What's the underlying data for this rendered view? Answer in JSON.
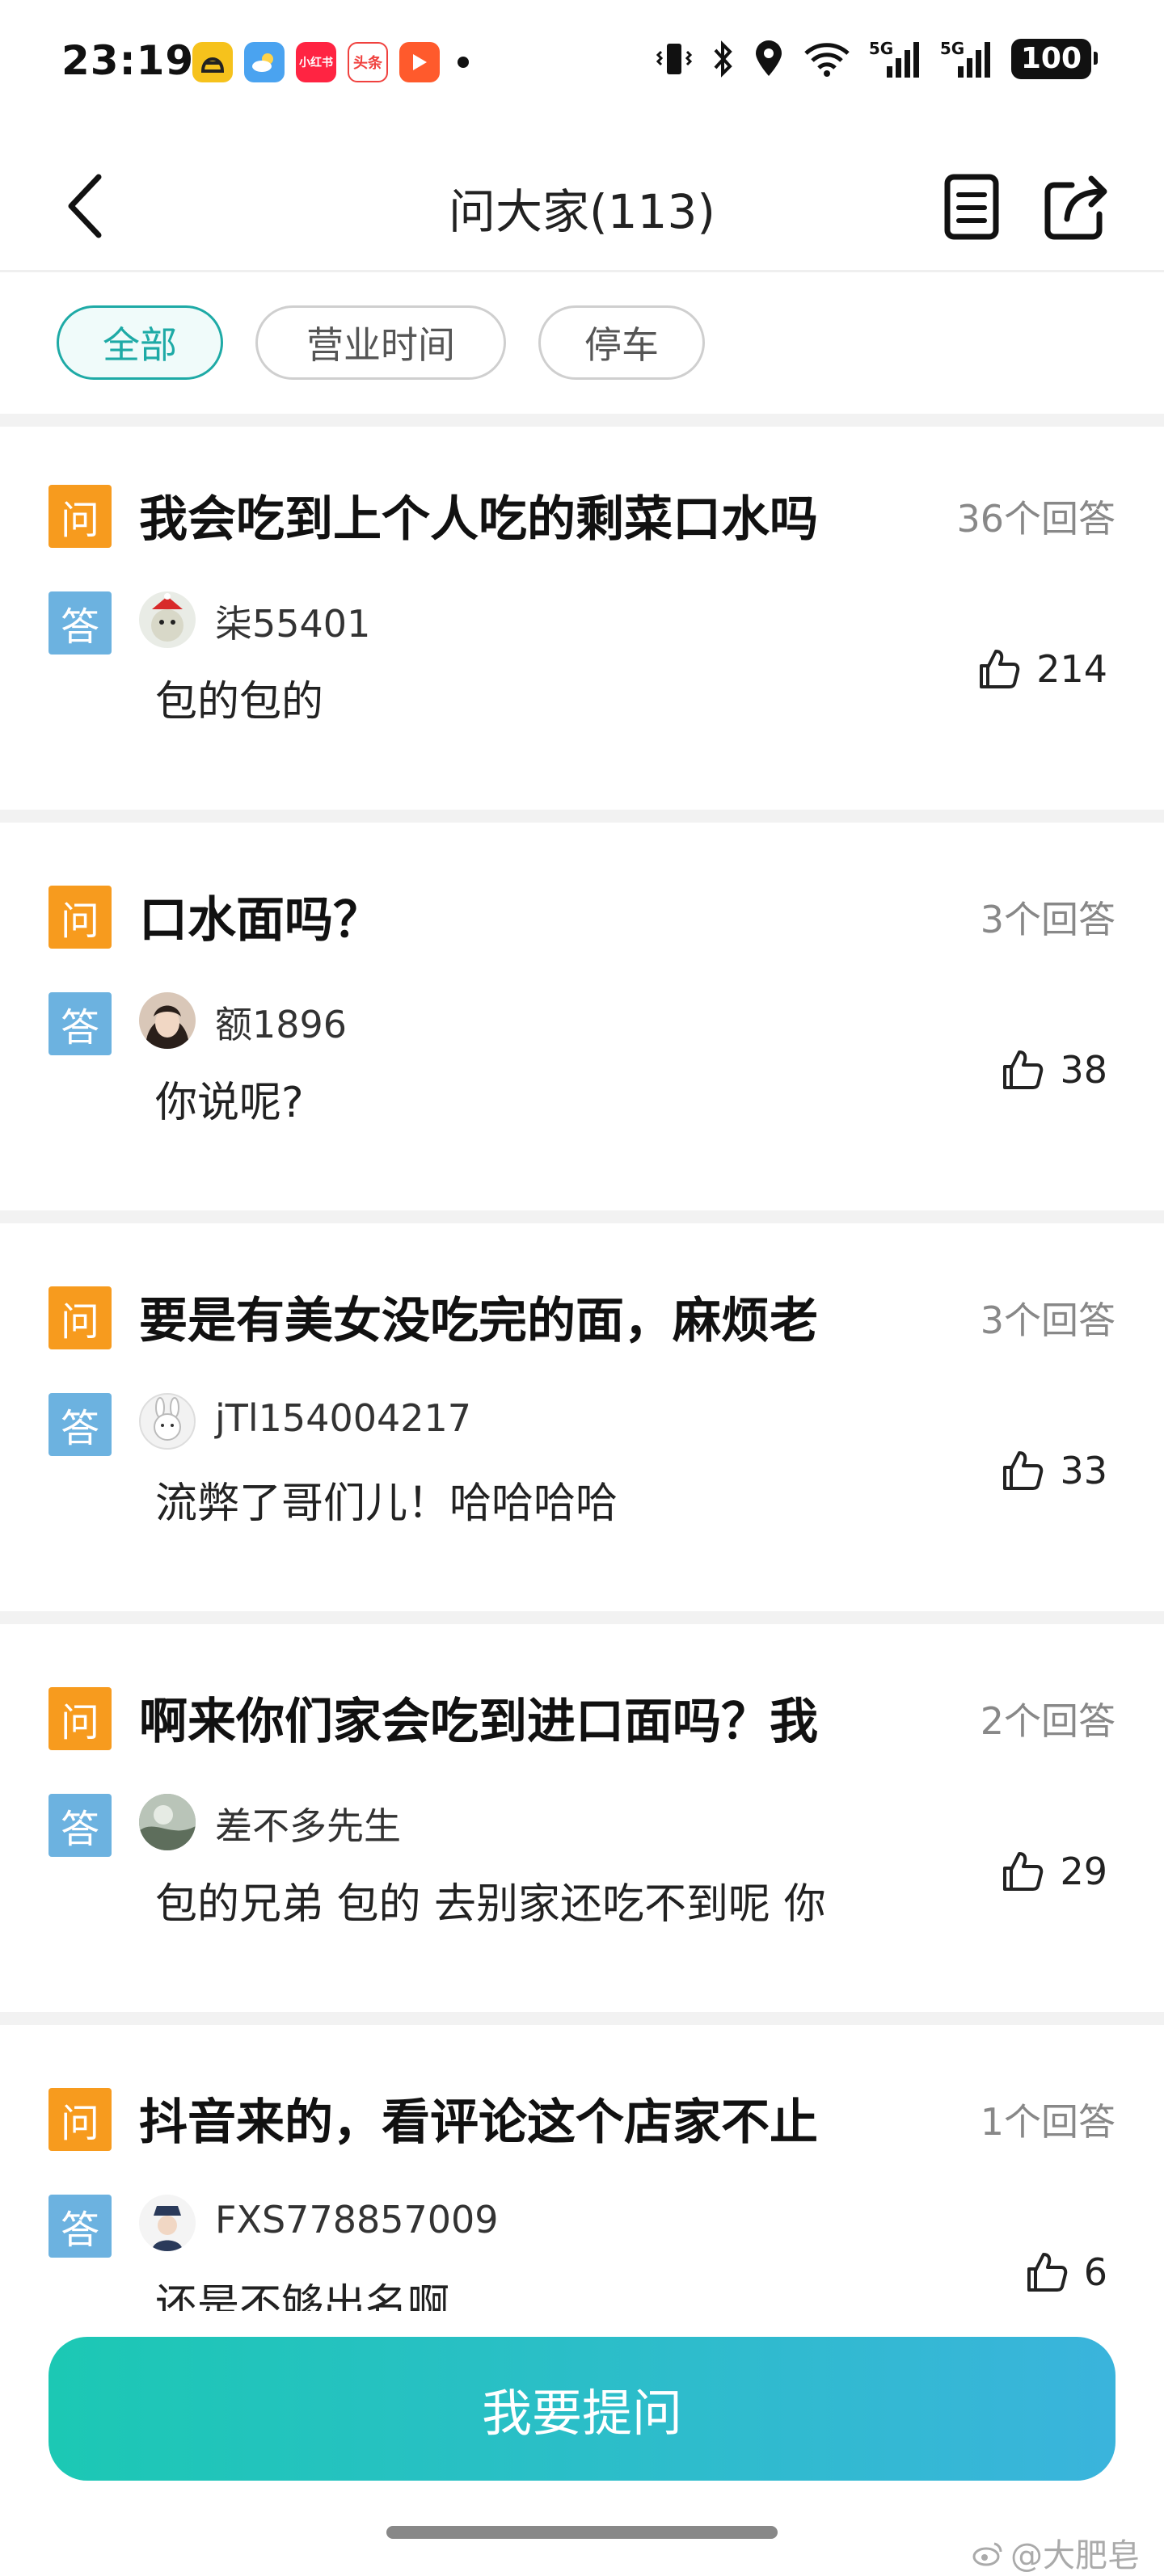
{
  "status_bar": {
    "time": "23:19",
    "apps": [
      {
        "icon": "gaode-app-icon",
        "color": "#f6c21c",
        "label": ""
      },
      {
        "icon": "weather-app-icon",
        "color": "#4aa3f0",
        "label": ""
      },
      {
        "icon": "xiaohongshu-app-icon",
        "color": "#ff2442",
        "label": "小红书"
      },
      {
        "icon": "toutiao-app-icon",
        "color": "#f0413e",
        "label": "头条"
      },
      {
        "icon": "video-app-icon",
        "color": "#ff5a2c",
        "label": ""
      }
    ],
    "battery": "100",
    "signal_1": "5G",
    "signal_2": "5G"
  },
  "navbar": {
    "title": "问大家(113)"
  },
  "filters": [
    {
      "label": "全部",
      "active": true
    },
    {
      "label": "营业时间",
      "active": false
    },
    {
      "label": "停车",
      "active": false
    }
  ],
  "items": [
    {
      "q_badge": "问",
      "question": "我会吃到上个人吃的剩菜口水吗",
      "count": "36个回答",
      "a_badge": "答",
      "user": "柒55401",
      "answer": "包的包的",
      "likes": "214",
      "avatar_color": "#3a5a3a"
    },
    {
      "q_badge": "问",
      "question": "口水面吗？",
      "count": "3个回答",
      "a_badge": "答",
      "user": "额1896",
      "answer": "你说呢?",
      "likes": "38",
      "avatar_color": "#6b4b3e"
    },
    {
      "q_badge": "问",
      "question": "要是有美女没吃完的面，麻烦老",
      "count": "3个回答",
      "a_badge": "答",
      "user": "jTl154004217",
      "answer": "流弊了哥们儿！哈哈哈哈",
      "likes": "33",
      "avatar_color": "#e8e8e8"
    },
    {
      "q_badge": "问",
      "question": "啊来你们家会吃到进口面吗？我",
      "count": "2个回答",
      "a_badge": "答",
      "user": "差不多先生",
      "answer": "包的兄弟 包的 去别家还吃不到呢 你",
      "likes": "29",
      "avatar_color": "#7d8a7a"
    },
    {
      "q_badge": "问",
      "question": "抖音来的，看评论这个店家不止",
      "count": "1个回答",
      "a_badge": "答",
      "user": "FXS778857009",
      "answer": "还是不够出名啊",
      "likes": "6",
      "avatar_color": "#2a3a5a"
    }
  ],
  "bottom": {
    "ask_button": "我要提问",
    "watermark": "@大肥皂"
  }
}
